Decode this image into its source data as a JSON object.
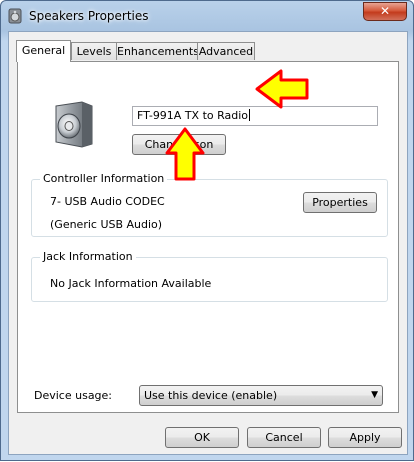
{
  "window": {
    "title": "Speakers Properties",
    "close_label": "✕"
  },
  "tabs": [
    {
      "label": "General",
      "active": true
    },
    {
      "label": "Levels",
      "active": false
    },
    {
      "label": "Enhancements",
      "active": false
    },
    {
      "label": "Advanced",
      "active": false
    }
  ],
  "general": {
    "device_name": "FT-991A TX to Radio",
    "change_icon_label": "Change Icon",
    "controller": {
      "title": "Controller Information",
      "line1": "7- USB Audio CODEC",
      "line2": "(Generic USB Audio)",
      "properties_label": "Properties"
    },
    "jack": {
      "title": "Jack Information",
      "text": "No Jack Information Available"
    },
    "device_usage": {
      "label": "Device usage:",
      "value": "Use this device (enable)"
    }
  },
  "footer": {
    "ok_label": "OK",
    "cancel_label": "Cancel",
    "apply_label": "Apply"
  },
  "colors": {
    "annotation_arrow_fill": "#ffff00",
    "annotation_arrow_stroke": "#ff0000"
  },
  "icons": {
    "window": "speaker-icon",
    "device": "speaker-icon"
  }
}
